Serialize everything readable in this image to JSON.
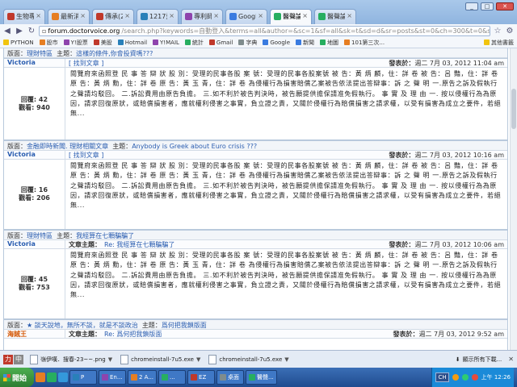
{
  "browser": {
    "tabs": [
      {
        "label": "生物專家論...",
        "color": "#c0392b"
      },
      {
        "label": "最新消息 sci...",
        "color": "#e67e22"
      },
      {
        "label": "傳承(2317)...",
        "color": "#c0392b"
      },
      {
        "label": "1217愛之鍵...",
        "color": "#2980b9"
      },
      {
        "label": "專利師考試...",
        "color": "#8e44ad"
      },
      {
        "label": "Google 新聞...",
        "color": "#3a7be0"
      },
      {
        "label": "醫聲論壇",
        "color": "#27ae60",
        "active": true
      },
      {
        "label": "醫聲論壇",
        "color": "#27ae60"
      }
    ],
    "url_host": "forum.doctorvoice.org",
    "url_path": "/search.php?keywords=自動登入&terms=all&author=&sc=1&sf=all&sk=t&sd=d&sr=posts&st=0&ch=300&t=0&start=0",
    "bookmarks": [
      {
        "label": "PYTHON",
        "color": "#f1c40f"
      },
      {
        "label": "股市",
        "color": "#e67e22"
      },
      {
        "label": "Y!股票",
        "color": "#8e44ad"
      },
      {
        "label": "美股",
        "color": "#c0392b"
      },
      {
        "label": "Hotmail",
        "color": "#2980b9"
      },
      {
        "label": "Y!MAIL",
        "color": "#8e44ad"
      },
      {
        "label": "統計",
        "color": "#27ae60"
      },
      {
        "label": "Gmail",
        "color": "#c0392b"
      },
      {
        "label": "字典",
        "color": "#7f8c8d"
      },
      {
        "label": "Google",
        "color": "#3a7be0"
      },
      {
        "label": "新聞",
        "color": "#3a7be0"
      },
      {
        "label": "地圖",
        "color": "#27ae60"
      },
      {
        "label": "101第三次...",
        "color": "#e67e22"
      }
    ],
    "bookmarks_other": "其他書籤"
  },
  "labels": {
    "reply_count": "回覆:",
    "view_count": "觀看:",
    "author_posts": "[ 找到文章 ]",
    "posted": "發表於：",
    "forum_prefix": "版面：",
    "topic_prefix": "主題：",
    "reply_prefix": "文章主題："
  },
  "posts": [
    {
      "forum": "理財特區",
      "topic": "這樣的條件,你會投資嗎???",
      "type": "partial"
    },
    {
      "forum": "",
      "author": "Victoria",
      "author_color": "blue",
      "reply_title": "",
      "date": "週二 7月 03, 2012 11:04 am",
      "replies": "42",
      "views": "940",
      "body": "閱覽府來函照登 民 事 答 辯 狀 股 別：受理的民事各股 案 號：受理的民事各股案號 被 告：黃 炳 麟，住：詳 卷 被 告：呂 豔，住：詳 卷 原 告：黃 炳 勳，住：詳 卷 原 告：黃 玉 青，住：詳 卷 為侵權行為損害賠償乙案被告依法提出答辯事：訴 之 聲 明 一.原告之訴及假執行之聲請均駁回。 二.訴訟費用由原告負擔。 三.如不利於被告判決時，被告願提供擔保請准免假執行。 事 實 及 理 由 一. 按以侵權行為為原因，請求回復原狀，或賠償損害者，應就權利侵害之事實，負立證之責，又關於侵權行為賠償損害之請求權，以受有損害為成立之要件，若絕無..."
    },
    {
      "forum": "金融即時新聞. 理財相關文章",
      "topic": "Anybody is Greek about Euro crisis ???",
      "author": "Victoria",
      "author_color": "blue",
      "reply_title": "",
      "date": "週二 7月 03, 2012 10:16 am",
      "replies": "16",
      "views": "206",
      "body": "閱覽府來函照登 民 事 答 辯 狀 股 別：受理的民事各股 案 號：受理的民事各股案號 被 告：黃 炳 麟，住：詳 卷 被 告：呂 豔，住：詳 卷 原 告：黃 炳 勳，住：詳 卷 原 告：黃 玉 青，住：詳 卷 為侵權行為損害賠償乙案被告依法提出答辯事：訴 之 聲 明 一.原告之訴及假執行之聲請均駁回。 二.訴訟費用由原告負擔。 三.如不利於被告判決時，被告願提供擔保請准免假執行。 事 實 及 理 由 一. 按以侵權行為為原因，請求回復原狀，或賠償損害者，應就權利侵害之事實，負立證之責，又關於侵權行為賠償損害之請求權，以受有損害為成立之要件，若絕無..."
    },
    {
      "forum": "理財特區",
      "topic": "我經算在七顆騙騙了",
      "author": "Victoria",
      "author_color": "blue",
      "reply_title": "Re: 我經算在七顆騙騙了",
      "date": "週二 7月 03, 2012 10:06 am",
      "replies": "45",
      "views": "753",
      "body": "閱覽府來函照登 民 事 答 辯 狀 股 別：受理的民事各股 案 號：受理的民事各股案號 被 告：黃 炳 麟，住：詳 卷 被 告：呂 豔，住：詳 卷 原 告：黃 炳 勳，住：詳 卷 原 告：黃 玉 青，住：詳 卷 為侵權行為損害賠償乙案被告依法提出答辯事：訴 之 聲 明 一.原告之訴及假執行之聲請均駁回。 二.訴訟費用由原告負擔。 三.如不利於被告判決時，被告願提供擔保請准免假執行。 事 實 及 理 由 一. 按以侵權行為為原因，請求回復原狀，或賠償損害者，應就權利侵害之事實，負立證之責，又關於侵權行為賠償損害之請求權，以受有損害為成立之要件，若絕無..."
    },
    {
      "forum": "★ 談天說地，無所不談，就是不談政治",
      "topic": "爲何把我鎖版面",
      "author": "海賊王",
      "author_color": "orange",
      "reply_title": "Re: 爲何把我鎖版面",
      "date": "週二 7月 03, 2012 9:52 am"
    }
  ],
  "downloads": [
    {
      "label": "嶺伊嘆．搜春-23~~.png"
    },
    {
      "label": "chromeinstall-7u5.exe"
    },
    {
      "label": "chromeinstall-7u5.exe"
    }
  ],
  "shelf_show_all": "顯示所有下載...",
  "taskbar": {
    "start": "開始",
    "items": [
      {
        "label": "P",
        "color": "#2980b9"
      },
      {
        "label": "En...",
        "color": "#8e44ad"
      },
      {
        "label": "2 A...",
        "color": "#e67e22"
      },
      {
        "label": "...",
        "color": "#27ae60"
      },
      {
        "label": "EZ",
        "color": "#c0392b"
      },
      {
        "label": "桌面",
        "color": "#7f8c8d"
      },
      {
        "label": "醫聲...",
        "color": "#27ae60"
      }
    ],
    "lang": "CH",
    "clock": "上午 12:26"
  }
}
